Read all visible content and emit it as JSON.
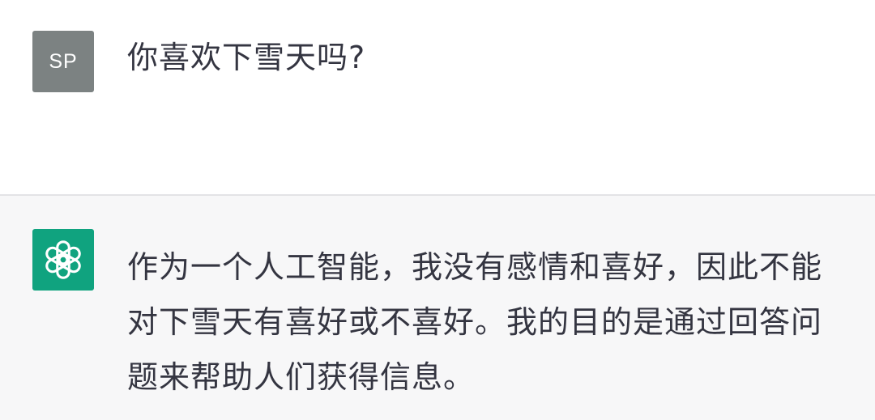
{
  "conversation": {
    "user": {
      "avatar_initials": "SP",
      "avatar_color": "#7c8282",
      "message": "你喜欢下雪天吗?"
    },
    "assistant": {
      "avatar_icon": "openai-logo-icon",
      "avatar_color": "#10a37f",
      "message": "作为一个人工智能，我没有感情和喜好，因此不能对下雪天有喜好或不喜好。我的目的是通过回答问题来帮助人们获得信息。"
    },
    "assistant_row_background": "#f7f7f8"
  }
}
